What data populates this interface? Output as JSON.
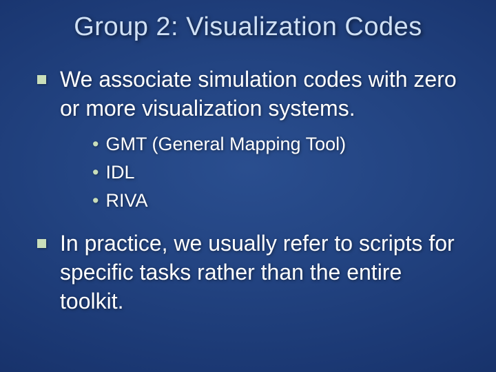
{
  "title": "Group 2: Visualization Codes",
  "points": [
    {
      "text": "We associate simulation codes with zero or more visualization systems.",
      "sub": [
        "GMT (General Mapping Tool)",
        "IDL",
        "RIVA"
      ]
    },
    {
      "text": "In practice, we usually refer to scripts for specific tasks rather than the entire toolkit.",
      "sub": []
    }
  ]
}
